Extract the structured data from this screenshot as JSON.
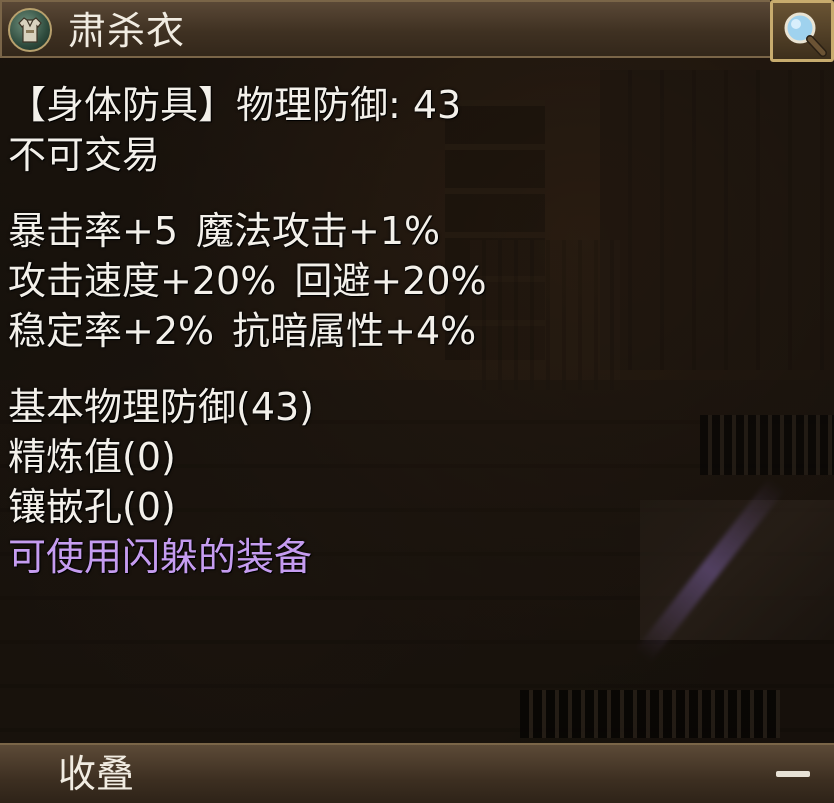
{
  "window": {
    "title": "肃杀衣",
    "item_icon": "armor-icon",
    "search_icon": "search-icon"
  },
  "item": {
    "type_line": "【身体防具】物理防御: 43",
    "trade_line": "不可交易",
    "stats": [
      [
        "暴击率+5",
        "魔法攻击+1%"
      ],
      [
        "攻击速度+20%",
        "回避+20%"
      ],
      [
        "稳定率+2%",
        "抗暗属性+4%"
      ]
    ],
    "base_defense": "基本物理防御(43)",
    "refine": "精炼值(0)",
    "sockets": "镶嵌孔(0)",
    "note": "可使用闪躲的装备",
    "note_color": "#c59cf0"
  },
  "footer": {
    "collapse_label": "收叠",
    "minus_icon": "minus-icon"
  }
}
